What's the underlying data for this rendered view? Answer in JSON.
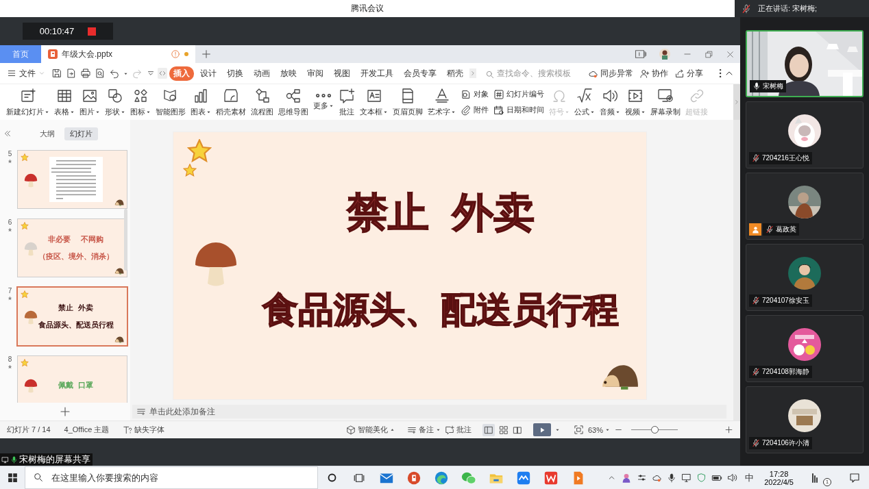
{
  "meeting": {
    "title": "腾讯会议",
    "speaking": "正在讲话: 宋树梅;",
    "timer": "00:10:47",
    "share_label": "宋树梅的屏幕共享"
  },
  "wps": {
    "home_tab": "首页",
    "doc_tab": {
      "title": "年级大会.pptx",
      "unsaved": true
    },
    "file_menu": "文件",
    "ribbon_tabs": [
      {
        "label": "插入",
        "selected": true
      },
      {
        "label": "设计",
        "selected": false
      },
      {
        "label": "切换",
        "selected": false
      },
      {
        "label": "动画",
        "selected": false
      },
      {
        "label": "放映",
        "selected": false
      },
      {
        "label": "审阅",
        "selected": false
      },
      {
        "label": "视图",
        "selected": false
      },
      {
        "label": "开发工具",
        "selected": false
      },
      {
        "label": "会员专享",
        "selected": false
      },
      {
        "label": "稻壳",
        "selected": false
      }
    ],
    "search_placeholder": "查找命令、搜索模板",
    "actions": [
      {
        "label": "同步异常"
      },
      {
        "label": "协作"
      },
      {
        "label": "分享"
      }
    ],
    "ribbon": [
      {
        "kind": "large",
        "label": "新建幻灯片",
        "dropdown": true,
        "disabled": false
      },
      {
        "kind": "large",
        "label": "表格",
        "dropdown": true,
        "disabled": false
      },
      {
        "kind": "large",
        "label": "图片",
        "dropdown": true,
        "disabled": false
      },
      {
        "kind": "large",
        "label": "形状",
        "dropdown": true,
        "disabled": false
      },
      {
        "kind": "large",
        "label": "图标",
        "dropdown": true,
        "disabled": false
      },
      {
        "kind": "large",
        "label": "智能图形",
        "dropdown": false,
        "disabled": false
      },
      {
        "kind": "large",
        "label": "图表",
        "dropdown": true,
        "disabled": false
      },
      {
        "kind": "large",
        "label": "稻壳素材",
        "dropdown": false,
        "disabled": false
      },
      {
        "kind": "large",
        "label": "流程图",
        "dropdown": false,
        "disabled": false
      },
      {
        "kind": "large",
        "label": "思维导图",
        "dropdown": false,
        "disabled": false
      },
      {
        "kind": "large",
        "label": "更多",
        "dropdown": true,
        "disabled": false
      },
      {
        "kind": "large",
        "label": "批注",
        "dropdown": false,
        "disabled": false
      },
      {
        "kind": "large",
        "label": "文本框",
        "dropdown": true,
        "disabled": false
      },
      {
        "kind": "large",
        "label": "页眉页脚",
        "dropdown": false,
        "disabled": false
      },
      {
        "kind": "large",
        "label": "艺术字",
        "dropdown": true,
        "disabled": false
      },
      {
        "kind": "pair",
        "items": [
          {
            "label": "对象"
          },
          {
            "label": "附件"
          }
        ]
      },
      {
        "kind": "pair",
        "items": [
          {
            "label": "幻灯片编号"
          },
          {
            "label": "日期和时间"
          }
        ]
      },
      {
        "kind": "large",
        "label": "符号",
        "dropdown": true,
        "disabled": true
      },
      {
        "kind": "large",
        "label": "公式",
        "dropdown": true,
        "disabled": false
      },
      {
        "kind": "large",
        "label": "音频",
        "dropdown": true,
        "disabled": false
      },
      {
        "kind": "large",
        "label": "视频",
        "dropdown": true,
        "disabled": false
      },
      {
        "kind": "large",
        "label": "屏幕录制",
        "dropdown": false,
        "disabled": false
      },
      {
        "kind": "large",
        "label": "超链接",
        "dropdown": false,
        "disabled": true
      }
    ],
    "panel_tabs": [
      {
        "label": "大纲",
        "selected": false
      },
      {
        "label": "幻灯片",
        "selected": true
      }
    ],
    "thumbnails": [
      {
        "number": "5",
        "selected": false,
        "kind": "text-image"
      },
      {
        "number": "6",
        "selected": false,
        "kind": "title",
        "color": "#c8584a",
        "lines": [
          "非必要     不网购",
          "（疫区、境外、消杀）"
        ]
      },
      {
        "number": "7",
        "selected": true,
        "kind": "title",
        "color": "#3a1010",
        "lines": [
          "禁止  外卖",
          "食品源头、配送员行程"
        ]
      },
      {
        "number": "8",
        "selected": false,
        "kind": "title",
        "color": "#5aa85a",
        "lines": [
          "佩戴  口罩"
        ]
      }
    ],
    "slide": {
      "title": "禁止  外卖",
      "subtitle": "食品源头、配送员行程"
    },
    "notes_placeholder": "单击此处添加备注",
    "status": {
      "slide_count": "幻灯片 7 / 14",
      "theme": "4_Office 主题",
      "missing_fonts": "缺失字体",
      "beautify": "智能美化",
      "notes": "备注",
      "comments": "批注",
      "zoom": "63%",
      "zoom_slider": {
        "level": 0.5
      }
    }
  },
  "participants": [
    {
      "name": "宋树梅",
      "muted": false,
      "speaking": true,
      "kind": "video",
      "role_icon": false
    },
    {
      "name": "7204216王心悦",
      "muted": true,
      "speaking": false,
      "kind": "avatar",
      "role_icon": false
    },
    {
      "name": "葛政英",
      "muted": true,
      "speaking": false,
      "kind": "avatar",
      "role_icon": true
    },
    {
      "name": "7204107徐安玉",
      "muted": true,
      "speaking": false,
      "kind": "avatar",
      "role_icon": false
    },
    {
      "name": "7204108郭海静",
      "muted": true,
      "speaking": false,
      "kind": "avatar",
      "role_icon": false
    },
    {
      "name": "7204106许小清",
      "muted": true,
      "speaking": false,
      "kind": "avatar",
      "role_icon": false
    }
  ],
  "taskbar": {
    "search_placeholder": "在这里输入你要搜索的内容",
    "ime": "中",
    "time": "17:28",
    "date": "2022/4/5",
    "notification_count": "1"
  }
}
